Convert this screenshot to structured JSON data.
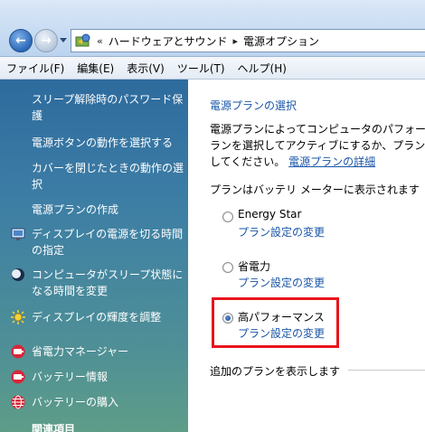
{
  "address": {
    "overflow": "«",
    "crumbs": [
      "ハードウェアとサウンド",
      "電源オプション"
    ]
  },
  "menu": [
    "ファイル(F)",
    "編集(E)",
    "表示(V)",
    "ツール(T)",
    "ヘルプ(H)"
  ],
  "tasks": [
    {
      "label": "スリープ解除時のパスワード保護"
    },
    {
      "label": "電源ボタンの動作を選択する"
    },
    {
      "label": "カバーを閉じたときの動作の選択"
    },
    {
      "label": "電源プランの作成"
    },
    {
      "label": "ディスプレイの電源を切る時間の指定",
      "icon": "display-power-icon"
    },
    {
      "label": "コンピュータがスリープ状態になる時間を変更",
      "icon": "sleep-moon-icon"
    },
    {
      "label": "ディスプレイの輝度を調整",
      "icon": "brightness-sun-icon"
    },
    {
      "label": "省電力マネージャー",
      "icon": "battery-icon"
    },
    {
      "label": "バッテリー情報",
      "icon": "battery-icon"
    },
    {
      "label": "バッテリーの購入",
      "icon": "globe-icon"
    }
  ],
  "related_heading": "関連項目",
  "content": {
    "title": "電源プランの選択",
    "desc_line1": "電源プランによってコンピュータのパフォー",
    "desc_line2": "ランを選択してアクティブにするか、プラン",
    "desc_line3": "してください。",
    "desc_link": "電源プランの詳細",
    "battery_meter": "プランはバッテリ メーターに表示されます",
    "plans": [
      {
        "name": "Energy Star",
        "link": "プラン設定の変更",
        "selected": false
      },
      {
        "name": "省電力",
        "link": "プラン設定の変更",
        "selected": false
      },
      {
        "name": "高パフォーマンス",
        "link": "プラン設定の変更",
        "selected": true
      }
    ],
    "show_more": "追加のプランを表示します"
  },
  "colors": {
    "highlight_border": "#e8141c",
    "link": "#1a56a8"
  }
}
